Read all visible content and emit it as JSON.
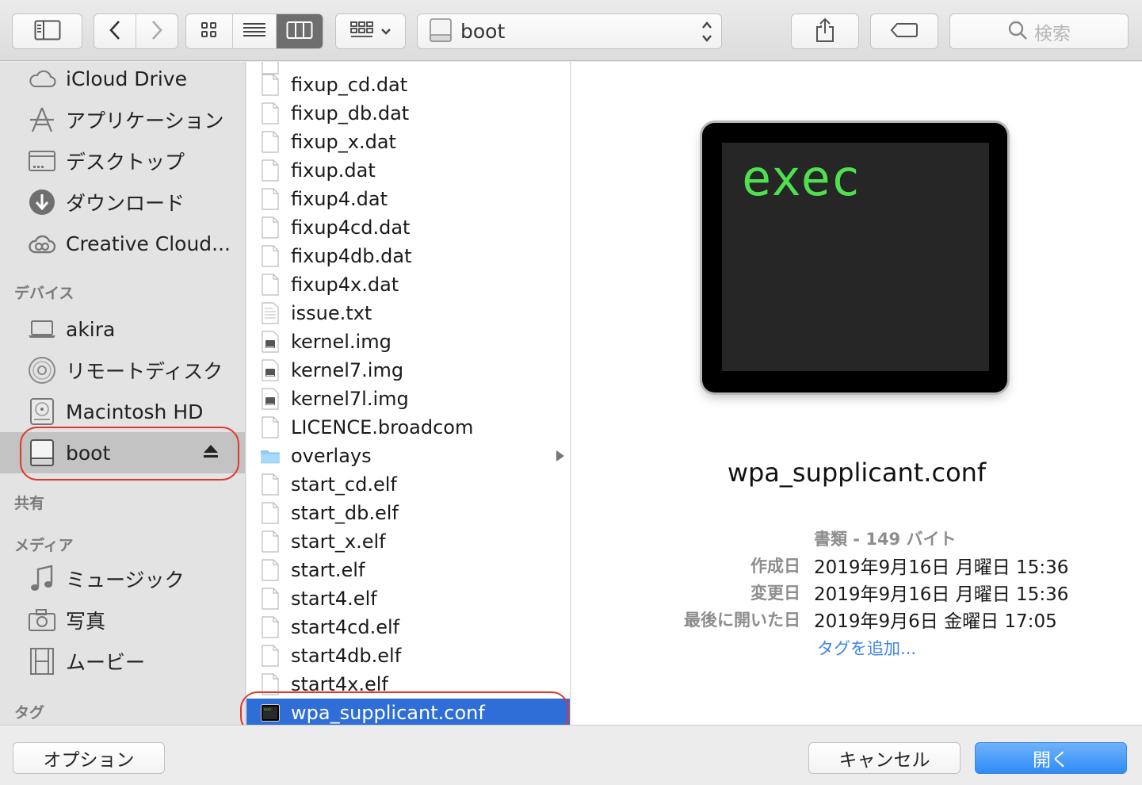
{
  "toolbar": {
    "location": "boot",
    "search_placeholder": "検索"
  },
  "sidebar": {
    "favorites": [
      {
        "label": "iCloud Drive",
        "icon": "cloud-icon"
      },
      {
        "label": "アプリケーション",
        "icon": "applications-icon"
      },
      {
        "label": "デスクトップ",
        "icon": "desktop-icon"
      },
      {
        "label": "ダウンロード",
        "icon": "download-icon"
      },
      {
        "label": "Creative Cloud...",
        "icon": "creative-cloud-icon"
      }
    ],
    "devices_header": "デバイス",
    "devices": [
      {
        "label": "akira",
        "icon": "laptop-icon"
      },
      {
        "label": "リモートディスク",
        "icon": "disc-icon"
      },
      {
        "label": "Macintosh HD",
        "icon": "hard-drive-icon"
      },
      {
        "label": "boot",
        "icon": "external-drive-icon"
      }
    ],
    "shared_header": "共有",
    "media_header": "メディア",
    "media": [
      {
        "label": "ミュージック",
        "icon": "music-icon"
      },
      {
        "label": "写真",
        "icon": "camera-icon"
      },
      {
        "label": "ムービー",
        "icon": "film-icon"
      }
    ],
    "tags_header": "タグ"
  },
  "files": [
    {
      "name": "fixup_cd.dat"
    },
    {
      "name": "fixup_db.dat"
    },
    {
      "name": "fixup_x.dat"
    },
    {
      "name": "fixup.dat"
    },
    {
      "name": "fixup4.dat"
    },
    {
      "name": "fixup4cd.dat"
    },
    {
      "name": "fixup4db.dat"
    },
    {
      "name": "fixup4x.dat"
    },
    {
      "name": "issue.txt"
    },
    {
      "name": "kernel.img"
    },
    {
      "name": "kernel7.img"
    },
    {
      "name": "kernel7l.img"
    },
    {
      "name": "LICENCE.broadcom"
    },
    {
      "name": "overlays"
    },
    {
      "name": "start_cd.elf"
    },
    {
      "name": "start_db.elf"
    },
    {
      "name": "start_x.elf"
    },
    {
      "name": "start.elf"
    },
    {
      "name": "start4.elf"
    },
    {
      "name": "start4cd.elf"
    },
    {
      "name": "start4db.elf"
    },
    {
      "name": "start4x.elf"
    },
    {
      "name": "wpa_supplicant.conf"
    }
  ],
  "preview": {
    "icon_text": "exec",
    "filename": "wpa_supplicant.conf",
    "kind": "書類 - 149 バイト",
    "created_label": "作成日",
    "created_value": "2019年9月16日 月曜日 15:36",
    "modified_label": "変更日",
    "modified_value": "2019年9月16日 月曜日 15:36",
    "opened_label": "最後に開いた日",
    "opened_value": "2019年9月6日 金曜日 17:05",
    "add_tags": "タグを追加..."
  },
  "footer": {
    "options": "オプション",
    "cancel": "キャンセル",
    "open": "開く"
  },
  "colors": {
    "selection": "#2f6ed6",
    "highlight_ring": "#e2372c",
    "primary_button": "#2f8bf6",
    "exec_text": "#4ee04e"
  }
}
